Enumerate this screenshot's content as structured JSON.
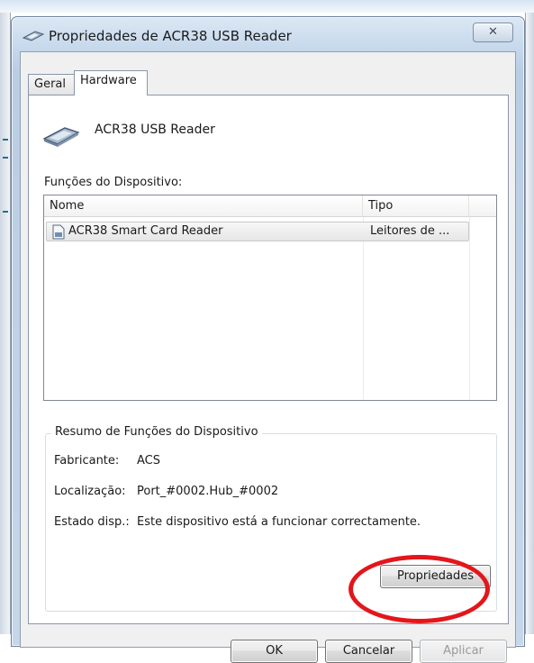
{
  "dialog": {
    "title": "Propriedades de ACR38 USB Reader",
    "close_glyph": "✕",
    "icon": "smart-card-reader-icon"
  },
  "tabs": [
    {
      "label": "Geral",
      "active": false
    },
    {
      "label": "Hardware",
      "active": true
    }
  ],
  "device": {
    "name": "ACR38 USB Reader",
    "functions_label": "Funções do Dispositivo:"
  },
  "list": {
    "columns": [
      "Nome",
      "Tipo"
    ],
    "rows": [
      {
        "name": "ACR38 Smart Card Reader",
        "type": "Leitores de ...",
        "icon": "device-file-icon"
      }
    ]
  },
  "summary": {
    "title": "Resumo de Funções do Dispositivo",
    "manufacturer_label": "Fabricante:",
    "manufacturer_value": "ACS",
    "location_label": "Localização:",
    "location_value": "Port_#0002.Hub_#0002",
    "status_label": "Estado disp.:",
    "status_value": "Este dispositivo está a funcionar correctamente.",
    "properties_button": "Propriedades"
  },
  "buttons": {
    "ok": "OK",
    "cancel": "Cancelar",
    "apply": "Aplicar"
  },
  "colors": {
    "highlight_ring": "#e3161b",
    "title_bar": "#c3d6ea"
  }
}
